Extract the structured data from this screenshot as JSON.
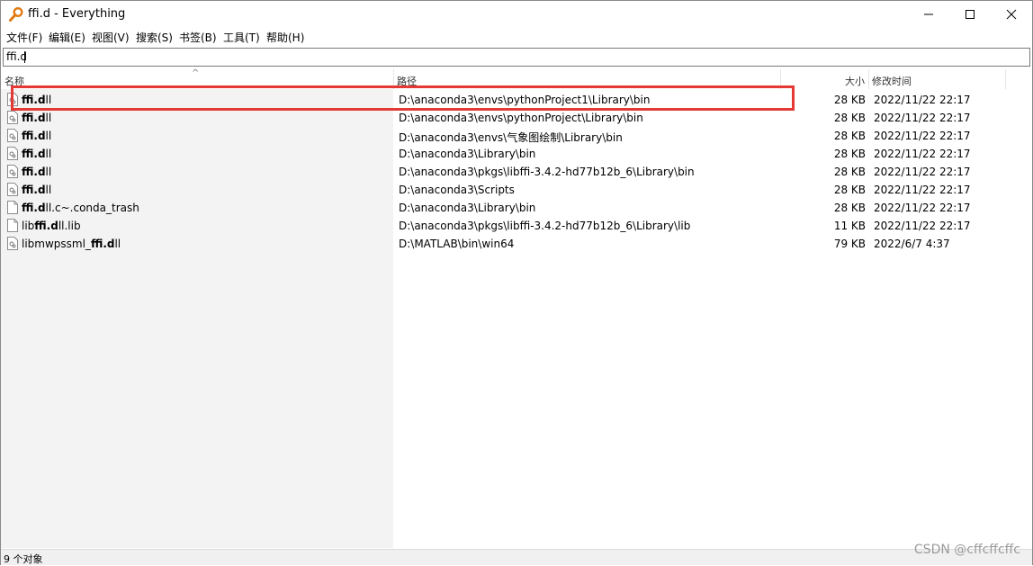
{
  "window": {
    "title": "ffi.d - Everything"
  },
  "menu": [
    "文件(F)",
    "编辑(E)",
    "视图(V)",
    "搜索(S)",
    "书签(B)",
    "工具(T)",
    "帮助(H)"
  ],
  "search": {
    "value": "ffi.d"
  },
  "columns": {
    "name": "名称",
    "path": "路径",
    "size": "大小",
    "modified": "修改时间"
  },
  "rows": [
    {
      "name_pre": "",
      "name_bold": "ffi.d",
      "name_post": "ll",
      "path": "D:\\anaconda3\\envs\\pythonProject1\\Library\\bin",
      "size": "28 KB",
      "modified": "2022/11/22 22:17",
      "icon": "dll-file-icon"
    },
    {
      "name_pre": "",
      "name_bold": "ffi.d",
      "name_post": "ll",
      "path": "D:\\anaconda3\\envs\\pythonProject\\Library\\bin",
      "size": "28 KB",
      "modified": "2022/11/22 22:17",
      "icon": "dll-file-icon"
    },
    {
      "name_pre": "",
      "name_bold": "ffi.d",
      "name_post": "ll",
      "path": "D:\\anaconda3\\envs\\气象图绘制\\Library\\bin",
      "size": "28 KB",
      "modified": "2022/11/22 22:17",
      "icon": "dll-file-icon"
    },
    {
      "name_pre": "",
      "name_bold": "ffi.d",
      "name_post": "ll",
      "path": "D:\\anaconda3\\Library\\bin",
      "size": "28 KB",
      "modified": "2022/11/22 22:17",
      "icon": "dll-file-icon"
    },
    {
      "name_pre": "",
      "name_bold": "ffi.d",
      "name_post": "ll",
      "path": "D:\\anaconda3\\pkgs\\libffi-3.4.2-hd77b12b_6\\Library\\bin",
      "size": "28 KB",
      "modified": "2022/11/22 22:17",
      "icon": "dll-file-icon"
    },
    {
      "name_pre": "",
      "name_bold": "ffi.d",
      "name_post": "ll",
      "path": "D:\\anaconda3\\Scripts",
      "size": "28 KB",
      "modified": "2022/11/22 22:17",
      "icon": "dll-file-icon"
    },
    {
      "name_pre": "",
      "name_bold": "ffi.d",
      "name_post": "ll.c~.conda_trash",
      "path": "D:\\anaconda3\\Library\\bin",
      "size": "28 KB",
      "modified": "2022/11/22 22:17",
      "icon": "blank-file-icon"
    },
    {
      "name_pre": "lib",
      "name_bold": "ffi.d",
      "name_post": "ll.lib",
      "path": "D:\\anaconda3\\pkgs\\libffi-3.4.2-hd77b12b_6\\Library\\lib",
      "size": "11 KB",
      "modified": "2022/11/22 22:17",
      "icon": "blank-file-icon"
    },
    {
      "name_pre": "libmwpssml_",
      "name_bold": "ffi.d",
      "name_post": "ll",
      "path": "D:\\MATLAB\\bin\\win64",
      "size": "79 KB",
      "modified": "2022/6/7 4:37",
      "icon": "dll-file-icon"
    }
  ],
  "status": {
    "text": "9 个对象"
  },
  "watermark": "CSDN @cffcffcffc",
  "colors": {
    "highlight": "#e53935",
    "name_column_bg": "#f3f3f3"
  }
}
